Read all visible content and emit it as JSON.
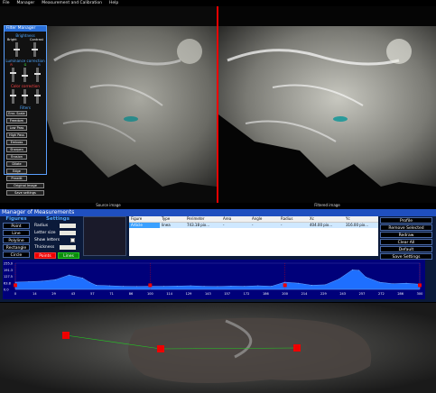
{
  "menu": [
    "File",
    "Manager",
    "Measurement and Calibration",
    "Help"
  ],
  "panes": {
    "left_caption": "Source image",
    "right_caption": "Filtered image"
  },
  "filter_manager": {
    "title": "Filter Manager",
    "sections": [
      "Brightness",
      "Luminance correction",
      "Color correction",
      "Filters"
    ],
    "slider_labels_top": [
      "Bright",
      "Contrast"
    ],
    "rgb_labels": [
      "R",
      "G",
      "B"
    ],
    "buttons": [
      "Emr. Scale",
      "Freedom",
      "Low Pass",
      "High Pass",
      "Emboss",
      "Sharpen",
      "Erosion",
      "Dilate",
      "Edge",
      "Prewitt",
      "Original Image",
      "Save settings"
    ]
  },
  "manager": {
    "title": "Manager of Measurements",
    "figures_header": "Figures",
    "figures": [
      "Point",
      "Line",
      "Polyline",
      "Rectangle",
      "Circle"
    ],
    "settings_header": "Settings",
    "settings": {
      "radius_label": "Radius",
      "letter_size_label": "Letter size",
      "show_letters_label": "Show letters",
      "thickness_label": "Thickness",
      "points_label": "Points",
      "lines_label": "Lines"
    },
    "table": {
      "headers": [
        "Figure",
        "Type",
        "Perimeter",
        "Area",
        "Angle",
        "Radius",
        "Xc",
        "Yc"
      ],
      "row": [
        "Article",
        "linea",
        "743.18 pix...",
        "-",
        "-",
        "-",
        "404.00 pix...",
        "316.00 pix..."
      ]
    },
    "actions": [
      "Profile",
      "Remove Selected",
      "Redraw",
      "Clear All",
      "Default",
      "Save Settings"
    ]
  },
  "chart_data": {
    "type": "area",
    "title": "",
    "xlabel": "",
    "ylabel": "",
    "y_tick_labels": [
      "255.0",
      "191.3",
      "127.5",
      "63.8",
      "0.0"
    ],
    "x_tick_labels": [
      "0",
      "14",
      "29",
      "43",
      "57",
      "71",
      "86",
      "100",
      "114",
      "129",
      "143",
      "157",
      "172",
      "186",
      "200",
      "214",
      "229",
      "243",
      "257",
      "272",
      "286",
      "300"
    ],
    "ylim": [
      0,
      255
    ],
    "xlim": [
      0,
      300
    ],
    "x": [
      0,
      10,
      20,
      30,
      40,
      50,
      55,
      60,
      70,
      80,
      90,
      100,
      110,
      120,
      130,
      140,
      150,
      160,
      170,
      180,
      190,
      200,
      210,
      220,
      230,
      240,
      250,
      255,
      260,
      270,
      280,
      290,
      300
    ],
    "values": [
      70,
      75,
      80,
      95,
      140,
      110,
      70,
      40,
      35,
      30,
      28,
      30,
      30,
      32,
      35,
      30,
      28,
      32,
      30,
      35,
      30,
      70,
      60,
      40,
      45,
      100,
      190,
      185,
      120,
      70,
      55,
      60,
      50
    ],
    "fill_color": "#1e6fff",
    "markers_x": [
      0,
      100,
      200,
      300
    ]
  },
  "colors": {
    "accent": "#1f4fbf",
    "divider": "#e00000",
    "marker": "#ff0000"
  }
}
